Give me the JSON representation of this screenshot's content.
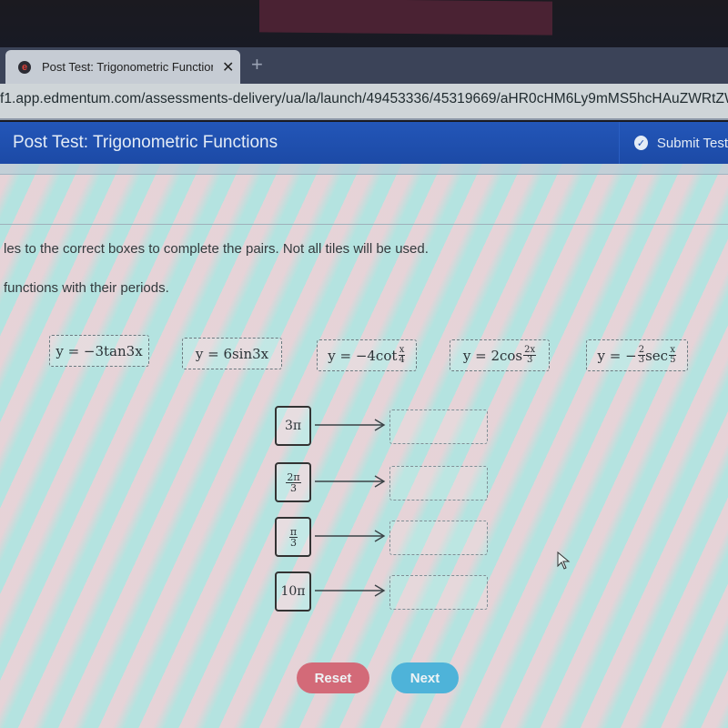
{
  "browser": {
    "tab_title": "Post Test: Trigonometric Function",
    "tab_close_glyph": "✕",
    "new_tab_glyph": "+",
    "favicon_glyph": "e",
    "url": "f1.app.edmentum.com/assessments-delivery/ua/la/launch/49453336/45319669/aHR0cHM6Ly9mMS5hcHAuZWRtZW50c"
  },
  "header": {
    "title": "Post Test: Trigonometric Functions",
    "submit_label": "Submit Test",
    "submit_icon": "check-circle-icon",
    "brand_color": "#1e4fb0"
  },
  "question": {
    "instruction_line1": "les to the correct boxes to complete the pairs. Not all tiles will be used.",
    "instruction_line2": "functions with their periods."
  },
  "tiles": [
    {
      "prefix": "y = −3tan3x",
      "frac": null,
      "suffix": ""
    },
    {
      "prefix": "y = 6sin3x",
      "frac": null,
      "suffix": ""
    },
    {
      "prefix": "y = −4cot",
      "frac": {
        "num": "x",
        "den": "4"
      },
      "suffix": ""
    },
    {
      "prefix": "y = 2cos",
      "frac": {
        "num": "2x",
        "den": "3"
      },
      "suffix": ""
    },
    {
      "prefix": "y = −",
      "frac": {
        "num": "2",
        "den": "3"
      },
      "mid": "sec",
      "frac2": {
        "num": "x",
        "den": "5"
      }
    }
  ],
  "periods": [
    {
      "text": "3π",
      "frac": null
    },
    {
      "text": "",
      "frac": {
        "num": "2π",
        "den": "3"
      }
    },
    {
      "text": "",
      "frac": {
        "num": "π",
        "den": "3"
      }
    },
    {
      "text": "10π",
      "frac": null
    }
  ],
  "buttons": {
    "reset_label": "Reset",
    "next_label": "Next",
    "reset_color": "#d36a78",
    "next_color": "#4eb3d9"
  }
}
